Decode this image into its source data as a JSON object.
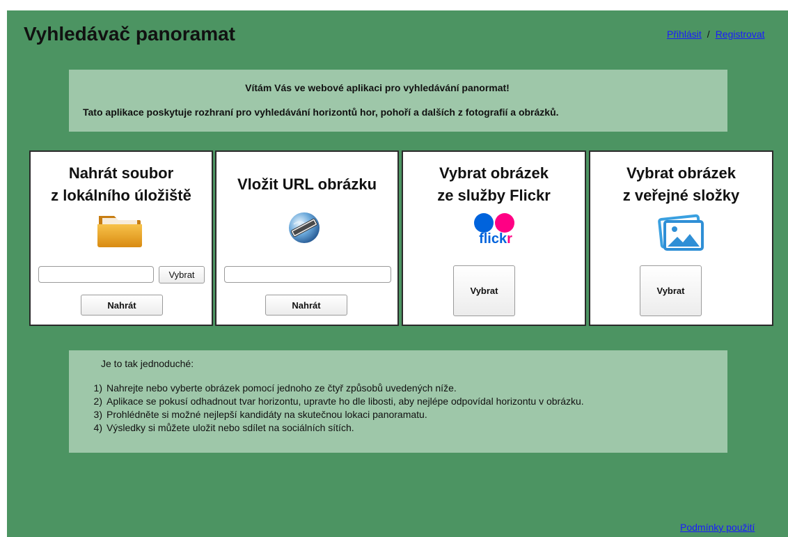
{
  "header": {
    "title": "Vyhledávač panoramat",
    "login": "Přihlásit",
    "separator": "/",
    "register": "Registrovat"
  },
  "welcome": {
    "line1": "Vítám Vás ve webové aplikaci pro vyhledávání panormat!",
    "line2": "Tato aplikace poskytuje rozhraní pro vyhledávání horizontů hor, pohoří a dalších z fotografií a obrázků."
  },
  "cards": {
    "local": {
      "title_line1": "Nahrát soubor",
      "title_line2": "z lokálního úložiště",
      "icon": "folder-icon",
      "choose_label": "Vybrat",
      "upload_label": "Nahrát",
      "file_value": ""
    },
    "url": {
      "title": "Vložit URL obrázku",
      "icon": "globe-url-icon",
      "url_value": "",
      "upload_label": "Nahrát"
    },
    "flickr": {
      "title_line1": "Vybrat obrázek",
      "title_line2": "ze služby Flickr",
      "logo_text_a": "flick",
      "logo_text_b": "r",
      "choose_label": "Vybrat"
    },
    "public": {
      "title_line1": "Vybrat obrázek",
      "title_line2": "z veřejné složky",
      "icon": "pictures-icon",
      "choose_label": "Vybrat"
    }
  },
  "info": {
    "intro": "Je to tak jednoduché:",
    "steps": [
      {
        "num": "1)",
        "text": "Nahrejte nebo vyberte obrázek pomocí jednoho ze čtyř způsobů uvedených níže."
      },
      {
        "num": "2)",
        "text": "Aplikace se pokusí odhadnout tvar horizontu, upravte ho dle libosti, aby nejlépe odpovídal horizontu v obrázku."
      },
      {
        "num": "3)",
        "text": "Prohlédněte si možné nejlepší kandidáty na skutečnou lokaci panoramatu."
      },
      {
        "num": "4)",
        "text": "Výsledky si můžete uložit nebo sdílet na sociálních sítích."
      }
    ]
  },
  "footer": {
    "terms": "Podmínky použití"
  },
  "colors": {
    "background": "#4c9462",
    "panel": "#9ec7a9",
    "link": "#1a1aff",
    "flickr_blue": "#0063dc",
    "flickr_pink": "#ff0084"
  }
}
